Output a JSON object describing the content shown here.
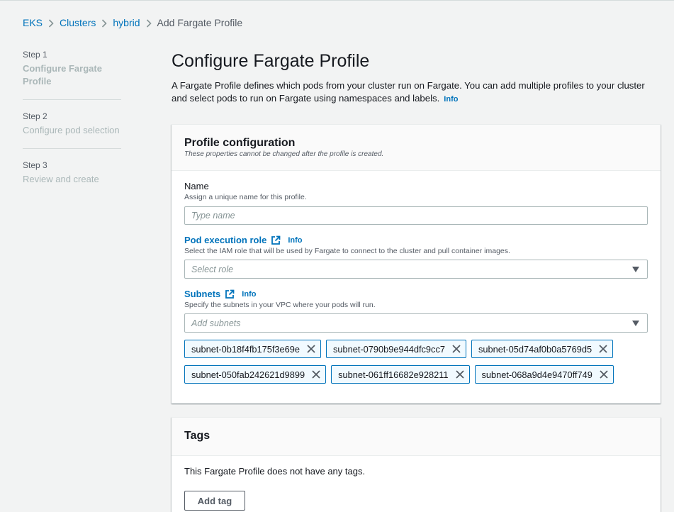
{
  "breadcrumb": {
    "items": [
      "EKS",
      "Clusters",
      "hybrid"
    ],
    "current": "Add Fargate Profile"
  },
  "steps": [
    {
      "num": "Step 1",
      "title": "Configure Fargate Profile"
    },
    {
      "num": "Step 2",
      "title": "Configure pod selection"
    },
    {
      "num": "Step 3",
      "title": "Review and create"
    }
  ],
  "page": {
    "title": "Configure Fargate Profile",
    "description": "A Fargate Profile defines which pods from your cluster run on Fargate. You can add multiple profiles to your cluster and select pods to run on Fargate using namespaces and labels.",
    "info_label": "Info"
  },
  "profile": {
    "title": "Profile configuration",
    "subtitle": "These properties cannot be changed after the profile is created.",
    "name": {
      "label": "Name",
      "description": "Assign a unique name for this profile.",
      "placeholder": "Type name",
      "value": ""
    },
    "role": {
      "label": "Pod execution role",
      "info": "Info",
      "description": "Select the IAM role that will be used by Fargate to connect to the cluster and pull container images.",
      "placeholder": "Select role"
    },
    "subnets": {
      "label": "Subnets",
      "info": "Info",
      "description": "Specify the subnets in your VPC where your pods will run.",
      "placeholder": "Add subnets",
      "selected": [
        "subnet-0b18f4fb175f3e69e",
        "subnet-0790b9e944dfc9cc7",
        "subnet-05d74af0b0a5769d5",
        "subnet-050fab242621d9899",
        "subnet-061ff16682e928211",
        "subnet-068a9d4e9470ff749"
      ]
    }
  },
  "tags": {
    "title": "Tags",
    "empty_text": "This Fargate Profile does not have any tags.",
    "add_button": "Add tag"
  },
  "colors": {
    "link": "#0073bb",
    "background": "#f2f3f3",
    "token_bg": "#f1faff"
  }
}
